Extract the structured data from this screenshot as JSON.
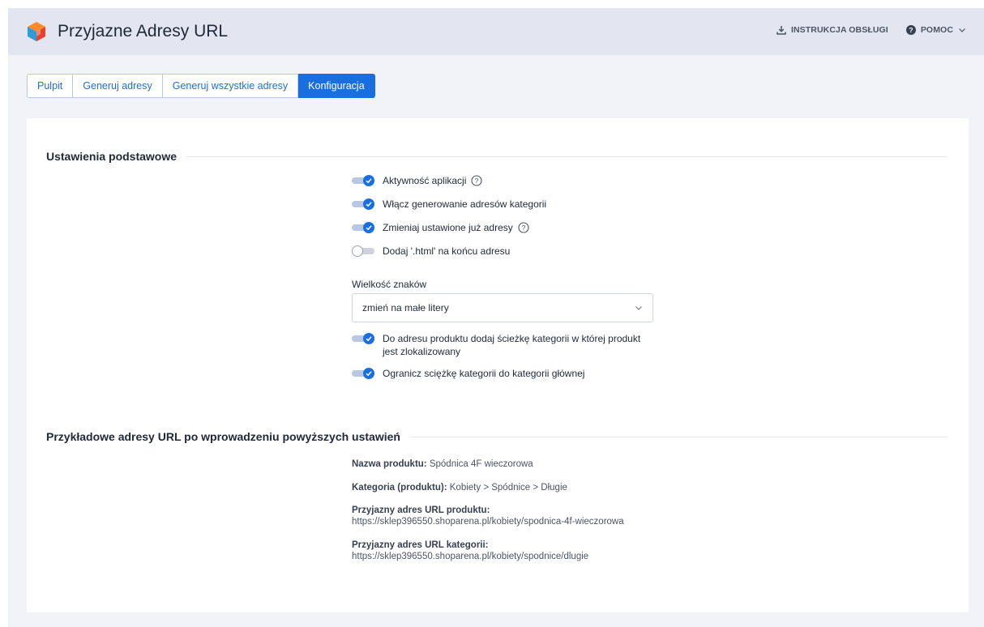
{
  "header": {
    "title": "Przyjazne Adresy URL",
    "manual_label": "INSTRUKCJA OBSŁUGI",
    "help_label": "POMOC"
  },
  "tabs": [
    {
      "label": "Pulpit",
      "active": false
    },
    {
      "label": "Generuj adresy",
      "active": false
    },
    {
      "label": "Generuj wszystkie adresy",
      "active": false
    },
    {
      "label": "Konfiguracja",
      "active": true
    }
  ],
  "basic": {
    "title": "Ustawienia podstawowe",
    "options": [
      {
        "label": "Aktywność aplikacji",
        "on": true,
        "help": true
      },
      {
        "label": "Włącz generowanie adresów kategorii",
        "on": true,
        "help": false
      },
      {
        "label": "Zmieniaj ustawione już adresy",
        "on": true,
        "help": true
      },
      {
        "label": "Dodaj '.html' na końcu adresu",
        "on": false,
        "help": false
      }
    ],
    "case_label": "Wielkość znaków",
    "case_value": "zmień na małe litery",
    "path_option": {
      "line1": "Do adresu produktu dodaj ścieżkę kategorii w której produkt",
      "line2": "jest zlokalizowany",
      "on": true
    },
    "limit_option": {
      "label": "Ogranicz sciężkę kategorii do kategorii głównej",
      "on": true
    }
  },
  "examples": {
    "title": "Przykładowe adresy URL po wprowadzeniu powyższych ustawień",
    "product_name_label": "Nazwa produktu:",
    "product_name_value": "Spódnica 4F wieczorowa",
    "category_label": "Kategoria (produktu):",
    "category_value": "Kobiety > Spódnice > Długie",
    "product_url_label": "Przyjazny adres URL produktu:",
    "product_url_value": "https://sklep396550.shoparena.pl/kobiety/spodnica-4f-wieczorowa",
    "category_url_label": "Przyjazny adres URL kategorii:",
    "category_url_value": "https://sklep396550.shoparena.pl/kobiety/spodnice/dlugie"
  },
  "colors": {
    "accent": "#1a6fe0",
    "header_bg": "#e3e6f0",
    "page_bg": "#f1f3f8"
  }
}
